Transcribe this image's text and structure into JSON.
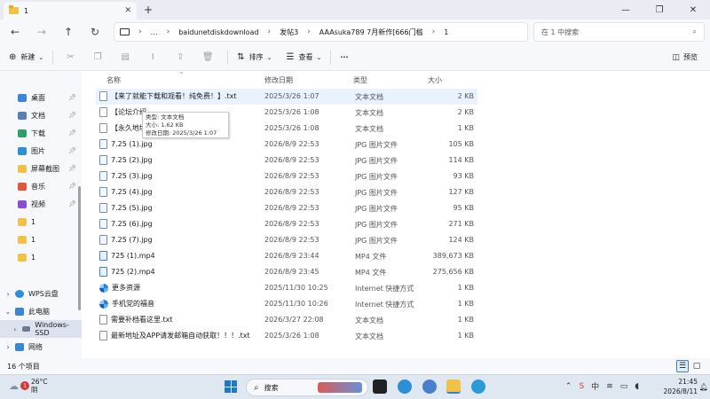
{
  "window": {
    "tab_title": "1",
    "tab_close": "✕",
    "new_tab": "+",
    "minimize": "—",
    "maximize": "❐",
    "close": "✕"
  },
  "nav": {
    "back": "←",
    "forward": "→",
    "up": "↑",
    "refresh": "↻",
    "more": "…",
    "breadcrumbs": [
      "baidunetdiskdownload",
      "发帖3",
      "AAAsuka789 7月新作[666门槛",
      "1"
    ],
    "search_placeholder": "在 1 中搜索"
  },
  "toolbar": {
    "new_label": "新建",
    "sort_label": "排序",
    "view_label": "查看",
    "more_label": "···",
    "preview_label": "预览"
  },
  "sidebar": {
    "quick": [
      {
        "label": "桌面",
        "icon": "desktop-icon",
        "color": "#3a86d6"
      },
      {
        "label": "文档",
        "icon": "documents-icon",
        "color": "#5b7fb0"
      },
      {
        "label": "下载",
        "icon": "downloads-icon",
        "color": "#2e9e6a"
      },
      {
        "label": "图片",
        "icon": "pictures-icon",
        "color": "#2f8fd8"
      },
      {
        "label": "屏幕截图",
        "icon": "folder-icon",
        "color": "#f2c247"
      },
      {
        "label": "音乐",
        "icon": "music-icon",
        "color": "#e0573c"
      },
      {
        "label": "视频",
        "icon": "videos-icon",
        "color": "#8a4fd0"
      },
      {
        "label": "1",
        "icon": "folder-icon",
        "color": "#f2c247"
      },
      {
        "label": "1",
        "icon": "folder-icon",
        "color": "#f2c247"
      },
      {
        "label": "1",
        "icon": "folder-icon",
        "color": "#f2c247"
      }
    ],
    "wps": "WPS云盘",
    "pc": "此电脑",
    "drive": "Windows-SSD",
    "network": "网络"
  },
  "columns": {
    "name": "名称",
    "date": "修改日期",
    "type": "类型",
    "size": "大小"
  },
  "files": [
    {
      "name": "【来了就能下载和观看！纯免费！】.txt",
      "date": "2025/3/26 1:07",
      "type": "文本文档",
      "size": "2 KB",
      "kind": "txt"
    },
    {
      "name": "【论坛介绍",
      "date": "2025/3/26 1:08",
      "type": "文本文档",
      "size": "2 KB",
      "kind": "txt"
    },
    {
      "name": "【永久地址",
      "date": "2025/3/26 1:08",
      "type": "文本文档",
      "size": "1 KB",
      "kind": "txt"
    },
    {
      "name": "7.25 (1).jpg",
      "date": "2026/8/9 22:53",
      "type": "JPG 图片文件",
      "size": "105 KB",
      "kind": "jpg"
    },
    {
      "name": "7.25 (2).jpg",
      "date": "2026/8/9 22:53",
      "type": "JPG 图片文件",
      "size": "114 KB",
      "kind": "jpg"
    },
    {
      "name": "7.25 (3).jpg",
      "date": "2026/8/9 22:53",
      "type": "JPG 图片文件",
      "size": "93 KB",
      "kind": "jpg"
    },
    {
      "name": "7.25 (4).jpg",
      "date": "2026/8/9 22:53",
      "type": "JPG 图片文件",
      "size": "127 KB",
      "kind": "jpg"
    },
    {
      "name": "7.25 (5).jpg",
      "date": "2026/8/9 22:53",
      "type": "JPG 图片文件",
      "size": "95 KB",
      "kind": "jpg"
    },
    {
      "name": "7.25 (6).jpg",
      "date": "2026/8/9 22:53",
      "type": "JPG 图片文件",
      "size": "271 KB",
      "kind": "jpg"
    },
    {
      "name": "7.25 (7).jpg",
      "date": "2026/8/9 22:53",
      "type": "JPG 图片文件",
      "size": "124 KB",
      "kind": "jpg"
    },
    {
      "name": "725 (1).mp4",
      "date": "2026/8/9 23:44",
      "type": "MP4 文件",
      "size": "389,673 KB",
      "kind": "mp4"
    },
    {
      "name": "725 (2).mp4",
      "date": "2026/8/9 23:45",
      "type": "MP4 文件",
      "size": "275,656 KB",
      "kind": "mp4"
    },
    {
      "name": "更多资源",
      "date": "2025/11/30 10:25",
      "type": "Internet 快捷方式",
      "size": "1 KB",
      "kind": "lnk"
    },
    {
      "name": "手机党的福音",
      "date": "2025/11/30 10:26",
      "type": "Internet 快捷方式",
      "size": "1 KB",
      "kind": "lnk"
    },
    {
      "name": "需要补档看这里.txt",
      "date": "2026/3/27 22:08",
      "type": "文本文档",
      "size": "1 KB",
      "kind": "txt"
    },
    {
      "name": "最新地址及APP请发邮箱自动获取！！！.txt",
      "date": "2025/3/26 1:08",
      "type": "文本文档",
      "size": "1 KB",
      "kind": "txt"
    }
  ],
  "tooltip": {
    "line1": "类型: 文本文档",
    "line2": "大小: 1.62 KB",
    "line3": "修改日期: 2025/3/26 1:07"
  },
  "status": {
    "count": "16 个项目"
  },
  "taskbar": {
    "weather_badge": "1",
    "temp": "26°C",
    "condition": "阴",
    "search_label": "搜索",
    "time": "21:45",
    "date": "2026/8/11"
  }
}
